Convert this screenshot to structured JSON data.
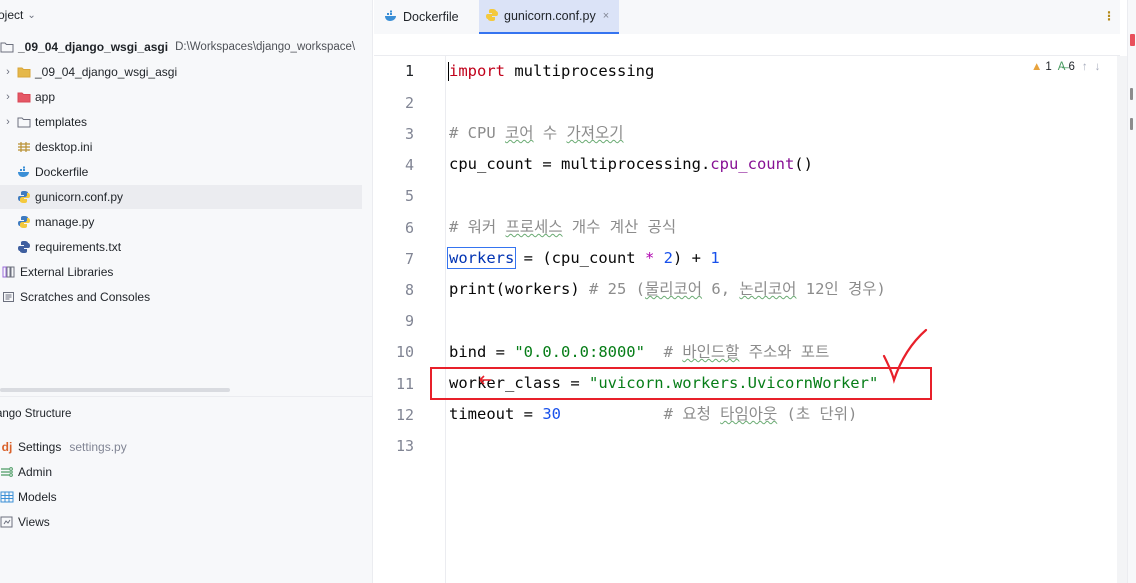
{
  "project_panel": {
    "title": "oject"
  },
  "tree": [
    {
      "label": "_09_04_django_wsgi_asgi",
      "path": "D:\\Workspaces\\django_workspace\\",
      "icon": "folder-icon"
    },
    {
      "label": "_09_04_django_wsgi_asgi",
      "icon": "folder-icon"
    },
    {
      "label": "app",
      "icon": "package-folder-icon"
    },
    {
      "label": "templates",
      "icon": "folder-icon"
    },
    {
      "label": "desktop.ini",
      "icon": "ini-file-icon"
    },
    {
      "label": "Dockerfile",
      "icon": "docker-icon"
    },
    {
      "label": "gunicorn.conf.py",
      "icon": "python-file-icon"
    },
    {
      "label": "manage.py",
      "icon": "python-file-icon"
    },
    {
      "label": "requirements.txt",
      "icon": "python-requirements-icon"
    },
    {
      "label": "External Libraries",
      "icon": "library-icon"
    },
    {
      "label": "Scratches and Consoles",
      "icon": "scratches-icon"
    }
  ],
  "structure_panel": {
    "title": "ango Structure",
    "items": [
      {
        "label": "Settings",
        "sub": "settings.py",
        "icon": "django-icon"
      },
      {
        "label": "Admin",
        "icon": "admin-icon"
      },
      {
        "label": "Models",
        "icon": "models-table-icon"
      },
      {
        "label": "Views",
        "icon": "views-icon"
      }
    ]
  },
  "tabs": [
    {
      "label": "Dockerfile",
      "icon": "docker-icon",
      "active": false
    },
    {
      "label": "gunicorn.conf.py",
      "icon": "python-file-icon",
      "active": true,
      "close": "×"
    }
  ],
  "tab_menu": "⋮",
  "inspections": {
    "warnings": "1",
    "typos": "6",
    "up": "↑",
    "down": "↓"
  },
  "line_numbers": [
    "1",
    "2",
    "3",
    "4",
    "5",
    "6",
    "7",
    "8",
    "9",
    "10",
    "11",
    "12",
    "13"
  ],
  "code": {
    "l1_kw": "import",
    "l1_rest": " multiprocessing",
    "l3_a": "# CPU ",
    "l3_b": "코어",
    "l3_c": " 수 ",
    "l3_d": "가져오기",
    "l4_a": "cpu_count = multiprocessing.",
    "l4_fn": "cpu_count",
    "l4_b": "()",
    "l6_a": "# 워커 ",
    "l6_b": "프로세스",
    "l6_c": " 개수 계산 공식",
    "l7_var": "workers",
    "l7_a": " = (cpu_count ",
    "l7_star": "*",
    "l7_n1": " 2",
    "l7_b": ") + ",
    "l7_n2": "1",
    "l8_a": "print(workers) ",
    "l8_c1": "# 25 (",
    "l8_c2": "물리코어",
    "l8_c3": " 6, ",
    "l8_c4": "논리코어",
    "l8_c5": " 12인 경우)",
    "l10_a": "bind = ",
    "l10_str": "\"0.0.0.0:8000\"",
    "l10_c1": "  # ",
    "l10_c2": "바인드할",
    "l10_c3": " 주소와 포트",
    "l11_a": "worker_class = ",
    "l11_str": "\"uvicorn.workers.UvicornWorker\"",
    "l12_a": "timeout = ",
    "l12_num": "30",
    "l12_c1": "           # 요청 ",
    "l12_c2": "타임아웃",
    "l12_c3": " (초 단위)"
  },
  "colors": {
    "accent": "#3574f0",
    "annotation_red": "#e8202a"
  }
}
